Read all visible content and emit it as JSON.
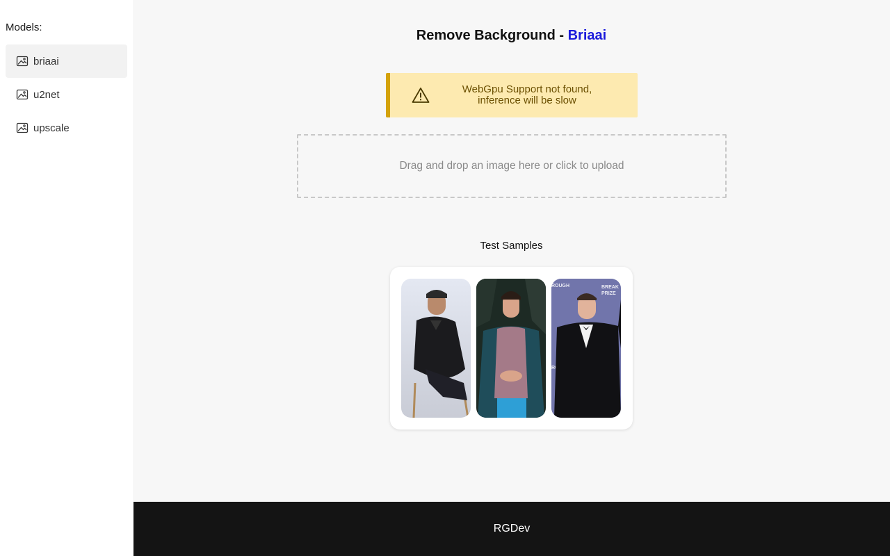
{
  "sidebar": {
    "title": "Models:",
    "items": [
      {
        "label": "briaai",
        "icon": "image-icon",
        "active": true
      },
      {
        "label": "u2net",
        "icon": "image-icon",
        "active": false
      },
      {
        "label": "upscale",
        "icon": "image-icon",
        "active": false
      }
    ]
  },
  "main": {
    "title_prefix": "Remove Background - ",
    "title_model": "Briaai",
    "warning": {
      "icon": "warning-icon",
      "line1": "WebGpu Support not found,",
      "line2": "inference will be slow"
    },
    "dropzone_text": "Drag and drop an image here or click to upload",
    "samples_title": "Test Samples",
    "samples": [
      {
        "name": "sample-1"
      },
      {
        "name": "sample-2"
      },
      {
        "name": "sample-3"
      }
    ]
  },
  "footer": {
    "text": "RGDev"
  },
  "colors": {
    "accent": "#1a1adb",
    "warning_bg": "#fdeab0",
    "warning_border": "#d4a20a",
    "footer_bg": "#141414"
  }
}
